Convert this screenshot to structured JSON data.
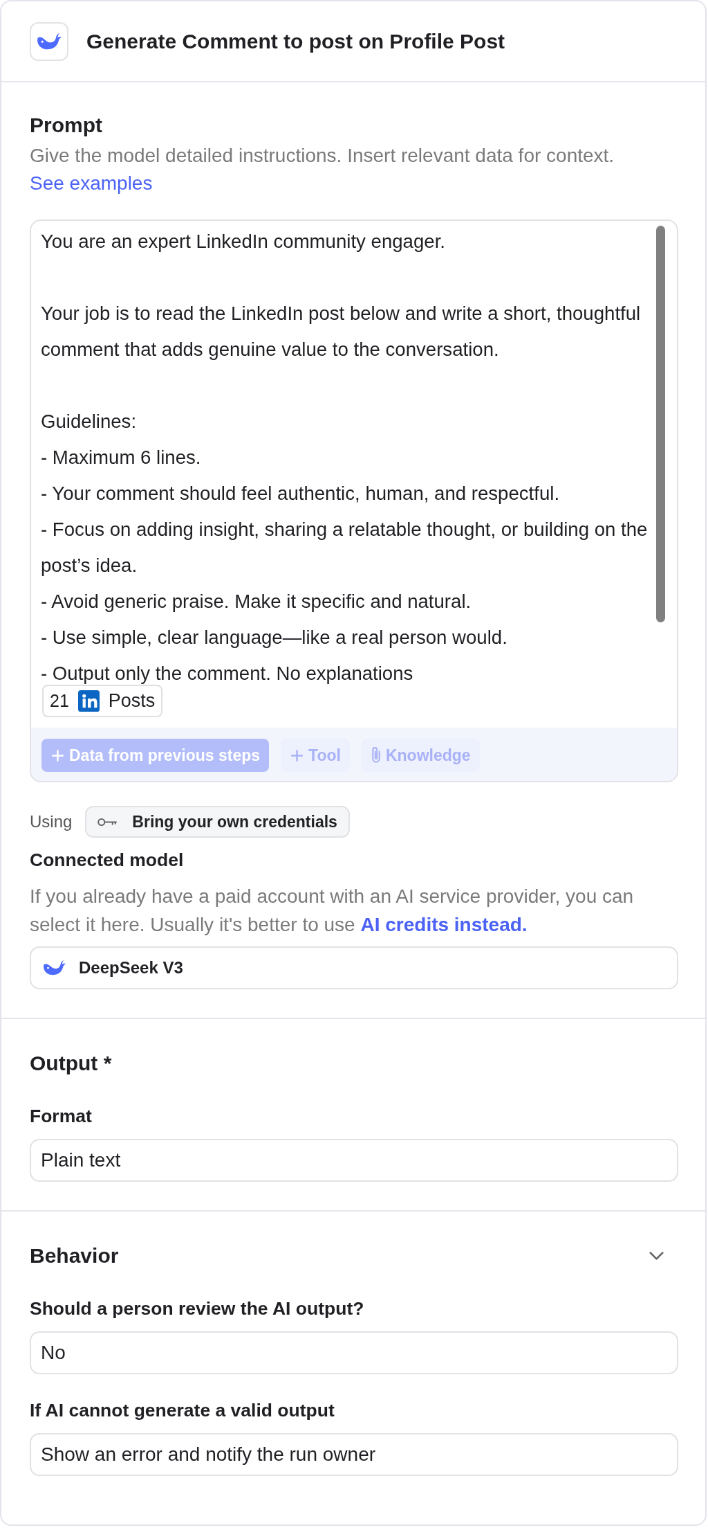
{
  "header": {
    "title": "Generate Comment to post on Profile Post"
  },
  "prompt": {
    "heading": "Prompt",
    "description": "Give the model detailed instructions. Insert relevant data for context.",
    "link": "See examples",
    "paragraphs": [
      {
        "lines": [
          "You are an expert LinkedIn community engager."
        ]
      },
      {
        "lines": [
          "Your job is to read the LinkedIn post below and write a short, thoughtful comment that adds genuine value to the conversation."
        ]
      },
      {
        "lines": [
          "Guidelines:",
          "- Maximum 6 lines.",
          "- Your comment should feel authentic, human, and respectful.",
          "- Focus on adding insight, sharing a relatable thought, or building on the post’s idea.",
          "- Avoid generic praise. Make it specific and natural.",
          "- Use simple, clear language—like a real person would.",
          "- Output only the comment. No explanations"
        ]
      }
    ],
    "variable": {
      "count": "21",
      "label": "Posts"
    },
    "toolbar": [
      {
        "kind": "primary",
        "label": "Data from previous steps",
        "disabled": true
      },
      {
        "kind": "add",
        "label": "Tool",
        "disabled": true
      },
      {
        "kind": "attach",
        "label": "Knowledge",
        "disabled": true
      }
    ]
  },
  "credentials": {
    "label": "Using",
    "button": "Bring your own credentials"
  },
  "connected_model": {
    "heading": "Connected model",
    "description": "If you already have a paid account with an AI service provider, you can select it here. Usually it's better to use",
    "link": "AI credits instead.",
    "value": "DeepSeek V3"
  },
  "output": {
    "heading": "Output *",
    "fields": [
      {
        "label": "Format",
        "value": "Plain text"
      }
    ]
  },
  "behavior": {
    "heading": "Behavior",
    "fields": [
      {
        "label": "Should a person review the AI output?",
        "value": "No"
      },
      {
        "label": "If AI cannot generate a valid output",
        "value": "Show an error and notify the run owner"
      }
    ]
  }
}
